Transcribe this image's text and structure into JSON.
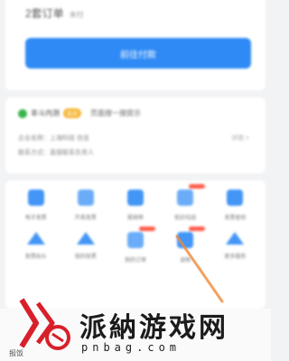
{
  "top_card": {
    "title": "2套订单",
    "title_tag": "未付",
    "primary_button": "前往付款"
  },
  "info_card": {
    "badge_label": "会员",
    "title": "幸斗内测",
    "extra": "页面搜一搜提示",
    "line_1": "企业名称：上海科技 信息",
    "line_2": "联系方式：直接联系负责人",
    "more": "详情 >"
  },
  "grid": {
    "items": [
      {
        "label": "电子发票",
        "icon": "calendar-icon",
        "shape": "square",
        "hot": false
      },
      {
        "label": "开具发票",
        "icon": "folder-icon",
        "shape": "square",
        "hot": false
      },
      {
        "label": "报销单",
        "icon": "document-icon",
        "shape": "square",
        "hot": false
      },
      {
        "label": "抵扣勾选",
        "icon": "folder-icon",
        "shape": "square",
        "hot": true
      },
      {
        "label": "发票查验",
        "icon": "document-icon",
        "shape": "square",
        "hot": false
      },
      {
        "label": "发票抬头",
        "icon": "mountain-icon",
        "shape": "tri",
        "hot": false
      },
      {
        "label": "我的收票",
        "icon": "mountain-icon",
        "shape": "tri",
        "hot": false
      },
      {
        "label": "我的订单",
        "icon": "document-icon",
        "shape": "square",
        "hot": true
      },
      {
        "label": "退税",
        "icon": "document-icon",
        "shape": "square",
        "hot": true
      },
      {
        "label": "更多服务",
        "icon": "mountain-icon",
        "shape": "tri",
        "hot": false
      }
    ]
  },
  "watermark": {
    "text": "派納游戏网",
    "url": "pnbag.com",
    "side": "报饭"
  },
  "colors": {
    "accent": "#2f8af5",
    "background": "#f2f3f5",
    "hot": "#ff5b4a",
    "orange_stroke": "#f08a3c"
  }
}
